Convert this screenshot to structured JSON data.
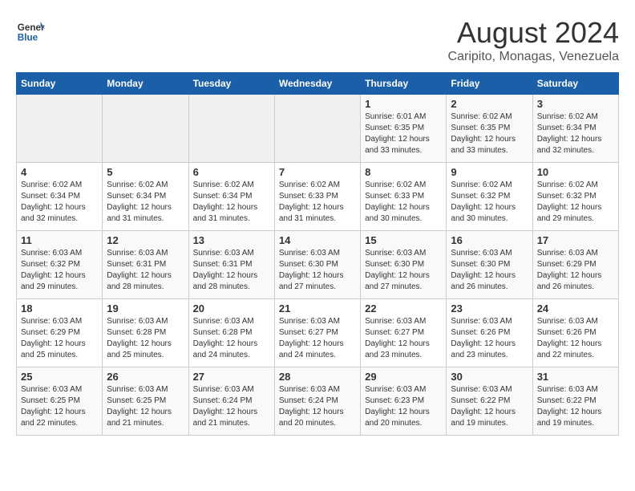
{
  "header": {
    "logo_line1": "General",
    "logo_line2": "Blue",
    "month": "August 2024",
    "location": "Caripito, Monagas, Venezuela"
  },
  "weekdays": [
    "Sunday",
    "Monday",
    "Tuesday",
    "Wednesday",
    "Thursday",
    "Friday",
    "Saturday"
  ],
  "weeks": [
    [
      {
        "day": "",
        "info": ""
      },
      {
        "day": "",
        "info": ""
      },
      {
        "day": "",
        "info": ""
      },
      {
        "day": "",
        "info": ""
      },
      {
        "day": "1",
        "info": "Sunrise: 6:01 AM\nSunset: 6:35 PM\nDaylight: 12 hours\nand 33 minutes."
      },
      {
        "day": "2",
        "info": "Sunrise: 6:02 AM\nSunset: 6:35 PM\nDaylight: 12 hours\nand 33 minutes."
      },
      {
        "day": "3",
        "info": "Sunrise: 6:02 AM\nSunset: 6:34 PM\nDaylight: 12 hours\nand 32 minutes."
      }
    ],
    [
      {
        "day": "4",
        "info": "Sunrise: 6:02 AM\nSunset: 6:34 PM\nDaylight: 12 hours\nand 32 minutes."
      },
      {
        "day": "5",
        "info": "Sunrise: 6:02 AM\nSunset: 6:34 PM\nDaylight: 12 hours\nand 31 minutes."
      },
      {
        "day": "6",
        "info": "Sunrise: 6:02 AM\nSunset: 6:34 PM\nDaylight: 12 hours\nand 31 minutes."
      },
      {
        "day": "7",
        "info": "Sunrise: 6:02 AM\nSunset: 6:33 PM\nDaylight: 12 hours\nand 31 minutes."
      },
      {
        "day": "8",
        "info": "Sunrise: 6:02 AM\nSunset: 6:33 PM\nDaylight: 12 hours\nand 30 minutes."
      },
      {
        "day": "9",
        "info": "Sunrise: 6:02 AM\nSunset: 6:32 PM\nDaylight: 12 hours\nand 30 minutes."
      },
      {
        "day": "10",
        "info": "Sunrise: 6:02 AM\nSunset: 6:32 PM\nDaylight: 12 hours\nand 29 minutes."
      }
    ],
    [
      {
        "day": "11",
        "info": "Sunrise: 6:03 AM\nSunset: 6:32 PM\nDaylight: 12 hours\nand 29 minutes."
      },
      {
        "day": "12",
        "info": "Sunrise: 6:03 AM\nSunset: 6:31 PM\nDaylight: 12 hours\nand 28 minutes."
      },
      {
        "day": "13",
        "info": "Sunrise: 6:03 AM\nSunset: 6:31 PM\nDaylight: 12 hours\nand 28 minutes."
      },
      {
        "day": "14",
        "info": "Sunrise: 6:03 AM\nSunset: 6:30 PM\nDaylight: 12 hours\nand 27 minutes."
      },
      {
        "day": "15",
        "info": "Sunrise: 6:03 AM\nSunset: 6:30 PM\nDaylight: 12 hours\nand 27 minutes."
      },
      {
        "day": "16",
        "info": "Sunrise: 6:03 AM\nSunset: 6:30 PM\nDaylight: 12 hours\nand 26 minutes."
      },
      {
        "day": "17",
        "info": "Sunrise: 6:03 AM\nSunset: 6:29 PM\nDaylight: 12 hours\nand 26 minutes."
      }
    ],
    [
      {
        "day": "18",
        "info": "Sunrise: 6:03 AM\nSunset: 6:29 PM\nDaylight: 12 hours\nand 25 minutes."
      },
      {
        "day": "19",
        "info": "Sunrise: 6:03 AM\nSunset: 6:28 PM\nDaylight: 12 hours\nand 25 minutes."
      },
      {
        "day": "20",
        "info": "Sunrise: 6:03 AM\nSunset: 6:28 PM\nDaylight: 12 hours\nand 24 minutes."
      },
      {
        "day": "21",
        "info": "Sunrise: 6:03 AM\nSunset: 6:27 PM\nDaylight: 12 hours\nand 24 minutes."
      },
      {
        "day": "22",
        "info": "Sunrise: 6:03 AM\nSunset: 6:27 PM\nDaylight: 12 hours\nand 23 minutes."
      },
      {
        "day": "23",
        "info": "Sunrise: 6:03 AM\nSunset: 6:26 PM\nDaylight: 12 hours\nand 23 minutes."
      },
      {
        "day": "24",
        "info": "Sunrise: 6:03 AM\nSunset: 6:26 PM\nDaylight: 12 hours\nand 22 minutes."
      }
    ],
    [
      {
        "day": "25",
        "info": "Sunrise: 6:03 AM\nSunset: 6:25 PM\nDaylight: 12 hours\nand 22 minutes."
      },
      {
        "day": "26",
        "info": "Sunrise: 6:03 AM\nSunset: 6:25 PM\nDaylight: 12 hours\nand 21 minutes."
      },
      {
        "day": "27",
        "info": "Sunrise: 6:03 AM\nSunset: 6:24 PM\nDaylight: 12 hours\nand 21 minutes."
      },
      {
        "day": "28",
        "info": "Sunrise: 6:03 AM\nSunset: 6:24 PM\nDaylight: 12 hours\nand 20 minutes."
      },
      {
        "day": "29",
        "info": "Sunrise: 6:03 AM\nSunset: 6:23 PM\nDaylight: 12 hours\nand 20 minutes."
      },
      {
        "day": "30",
        "info": "Sunrise: 6:03 AM\nSunset: 6:22 PM\nDaylight: 12 hours\nand 19 minutes."
      },
      {
        "day": "31",
        "info": "Sunrise: 6:03 AM\nSunset: 6:22 PM\nDaylight: 12 hours\nand 19 minutes."
      }
    ]
  ]
}
